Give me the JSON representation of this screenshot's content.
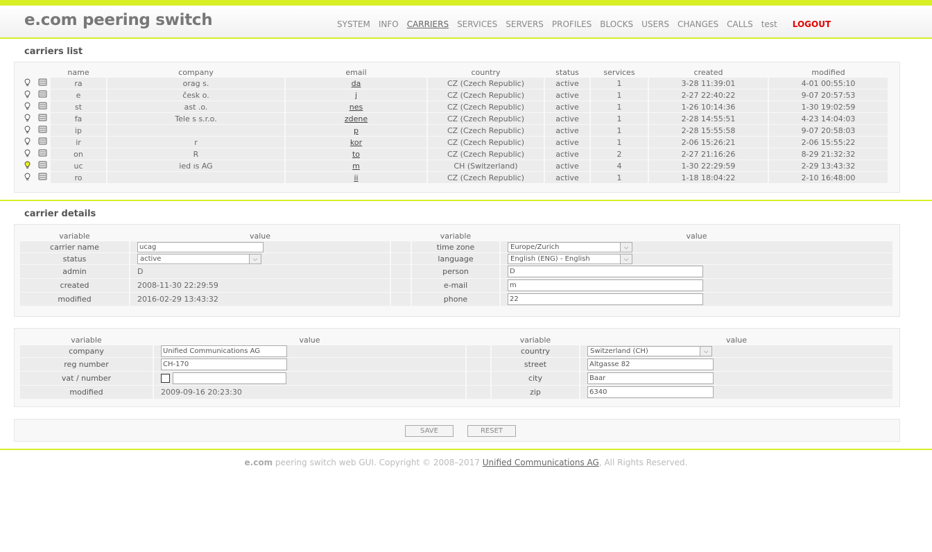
{
  "app": {
    "title": "e.com peering switch"
  },
  "nav": {
    "items": [
      "SYSTEM",
      "INFO",
      "CARRIERS",
      "SERVICES",
      "SERVERS",
      "PROFILES",
      "BLOCKS",
      "USERS",
      "CHANGES",
      "CALLS",
      "test"
    ],
    "active": "CARRIERS",
    "logout": "LOGOUT"
  },
  "carriers_list": {
    "title": "carriers list",
    "headers": [
      "name",
      "company",
      "email",
      "country",
      "status",
      "services",
      "created",
      "modified"
    ],
    "rows": [
      {
        "name": "ra",
        "company": "orag                  s.",
        "email": "da",
        "country": "CZ (Czech Republic)",
        "status": "active",
        "services": "1",
        "created": "3-28 11:39:01",
        "modified": "4-01 00:55:10",
        "selected": false
      },
      {
        "name": "e",
        "company": "česk                    o.",
        "email": "j",
        "country": "CZ (Czech Republic)",
        "status": "active",
        "services": "1",
        "created": "2-27 22:40:22",
        "modified": "9-07 20:57:53",
        "selected": false
      },
      {
        "name": "st",
        "company": "ast                    .o.",
        "email": "nes",
        "country": "CZ (Czech Republic)",
        "status": "active",
        "services": "1",
        "created": "1-26 10:14:36",
        "modified": "1-30 19:02:59",
        "selected": false
      },
      {
        "name": "fa",
        "company": "Tele                  s s.r.o.",
        "email": "zdene",
        "country": "CZ (Czech Republic)",
        "status": "active",
        "services": "1",
        "created": "2-28 14:55:51",
        "modified": "4-23 14:04:03",
        "selected": false
      },
      {
        "name": "ip",
        "company": "",
        "email": "p",
        "country": "CZ (Czech Republic)",
        "status": "active",
        "services": "1",
        "created": "2-28 15:55:58",
        "modified": "9-07 20:58:03",
        "selected": false
      },
      {
        "name": "ir",
        "company": "r",
        "email": "kor",
        "country": "CZ (Czech Republic)",
        "status": "active",
        "services": "1",
        "created": "2-06 15:26:21",
        "modified": "2-06 15:55:22",
        "selected": false
      },
      {
        "name": "on",
        "company": "R",
        "email": "to",
        "country": "CZ (Czech Republic)",
        "status": "active",
        "services": "2",
        "created": "2-27 21:16:26",
        "modified": "8-29 21:32:32",
        "selected": false
      },
      {
        "name": "uc",
        "company": "ied                   ıs AG",
        "email": "m",
        "country": "CH (Switzerland)",
        "status": "active",
        "services": "4",
        "created": "1-30 22:29:59",
        "modified": "2-29 13:43:32",
        "selected": true
      },
      {
        "name": "ro",
        "company": "",
        "email": "ii",
        "country": "CZ (Czech Republic)",
        "status": "active",
        "services": "1",
        "created": "1-18 18:04:22",
        "modified": "2-10 16:48:00",
        "selected": false
      }
    ]
  },
  "carrier_details": {
    "title": "carrier details",
    "headers": {
      "variable": "variable",
      "value": "value"
    },
    "carrier_name": {
      "label": "carrier name",
      "value": "ucag"
    },
    "status": {
      "label": "status",
      "value": "active"
    },
    "admin": {
      "label": "admin",
      "value": "D"
    },
    "created": {
      "label": "created",
      "value": "2008-11-30 22:29:59"
    },
    "modified": {
      "label": "modified",
      "value": "2016-02-29 13:43:32"
    },
    "time_zone": {
      "label": "time zone",
      "value": "Europe/Zurich"
    },
    "language": {
      "label": "language",
      "value": "English (ENG) - English"
    },
    "person": {
      "label": "person",
      "value": "D"
    },
    "email": {
      "label": "e-mail",
      "value": "m"
    },
    "phone": {
      "label": "phone",
      "value": "22"
    }
  },
  "company_details": {
    "headers": {
      "variable": "variable",
      "value": "value"
    },
    "company": {
      "label": "company",
      "value": "Unified Communications AG"
    },
    "reg_number": {
      "label": "reg number",
      "value": "CH-170"
    },
    "vat_number": {
      "label": "vat / number",
      "value": ""
    },
    "modified": {
      "label": "modified",
      "value": "2009-09-16 20:23:30"
    },
    "country": {
      "label": "country",
      "value": "Switzerland (CH)"
    },
    "street": {
      "label": "street",
      "value": "Altgasse 82"
    },
    "city": {
      "label": "city",
      "value": "Baar"
    },
    "zip": {
      "label": "zip",
      "value": "6340"
    }
  },
  "buttons": {
    "save": "SAVE",
    "reset": "RESET"
  },
  "footer": {
    "brand": "e.com",
    "text": "peering switch web GUI. Copyright © 2008–2017",
    "company": "Unified Communications AG",
    "suffix": ", All Rights Reserved."
  },
  "colors": {
    "accent": "#d8ef27",
    "logout": "#e00000",
    "bulb_on": "#e8f020"
  }
}
